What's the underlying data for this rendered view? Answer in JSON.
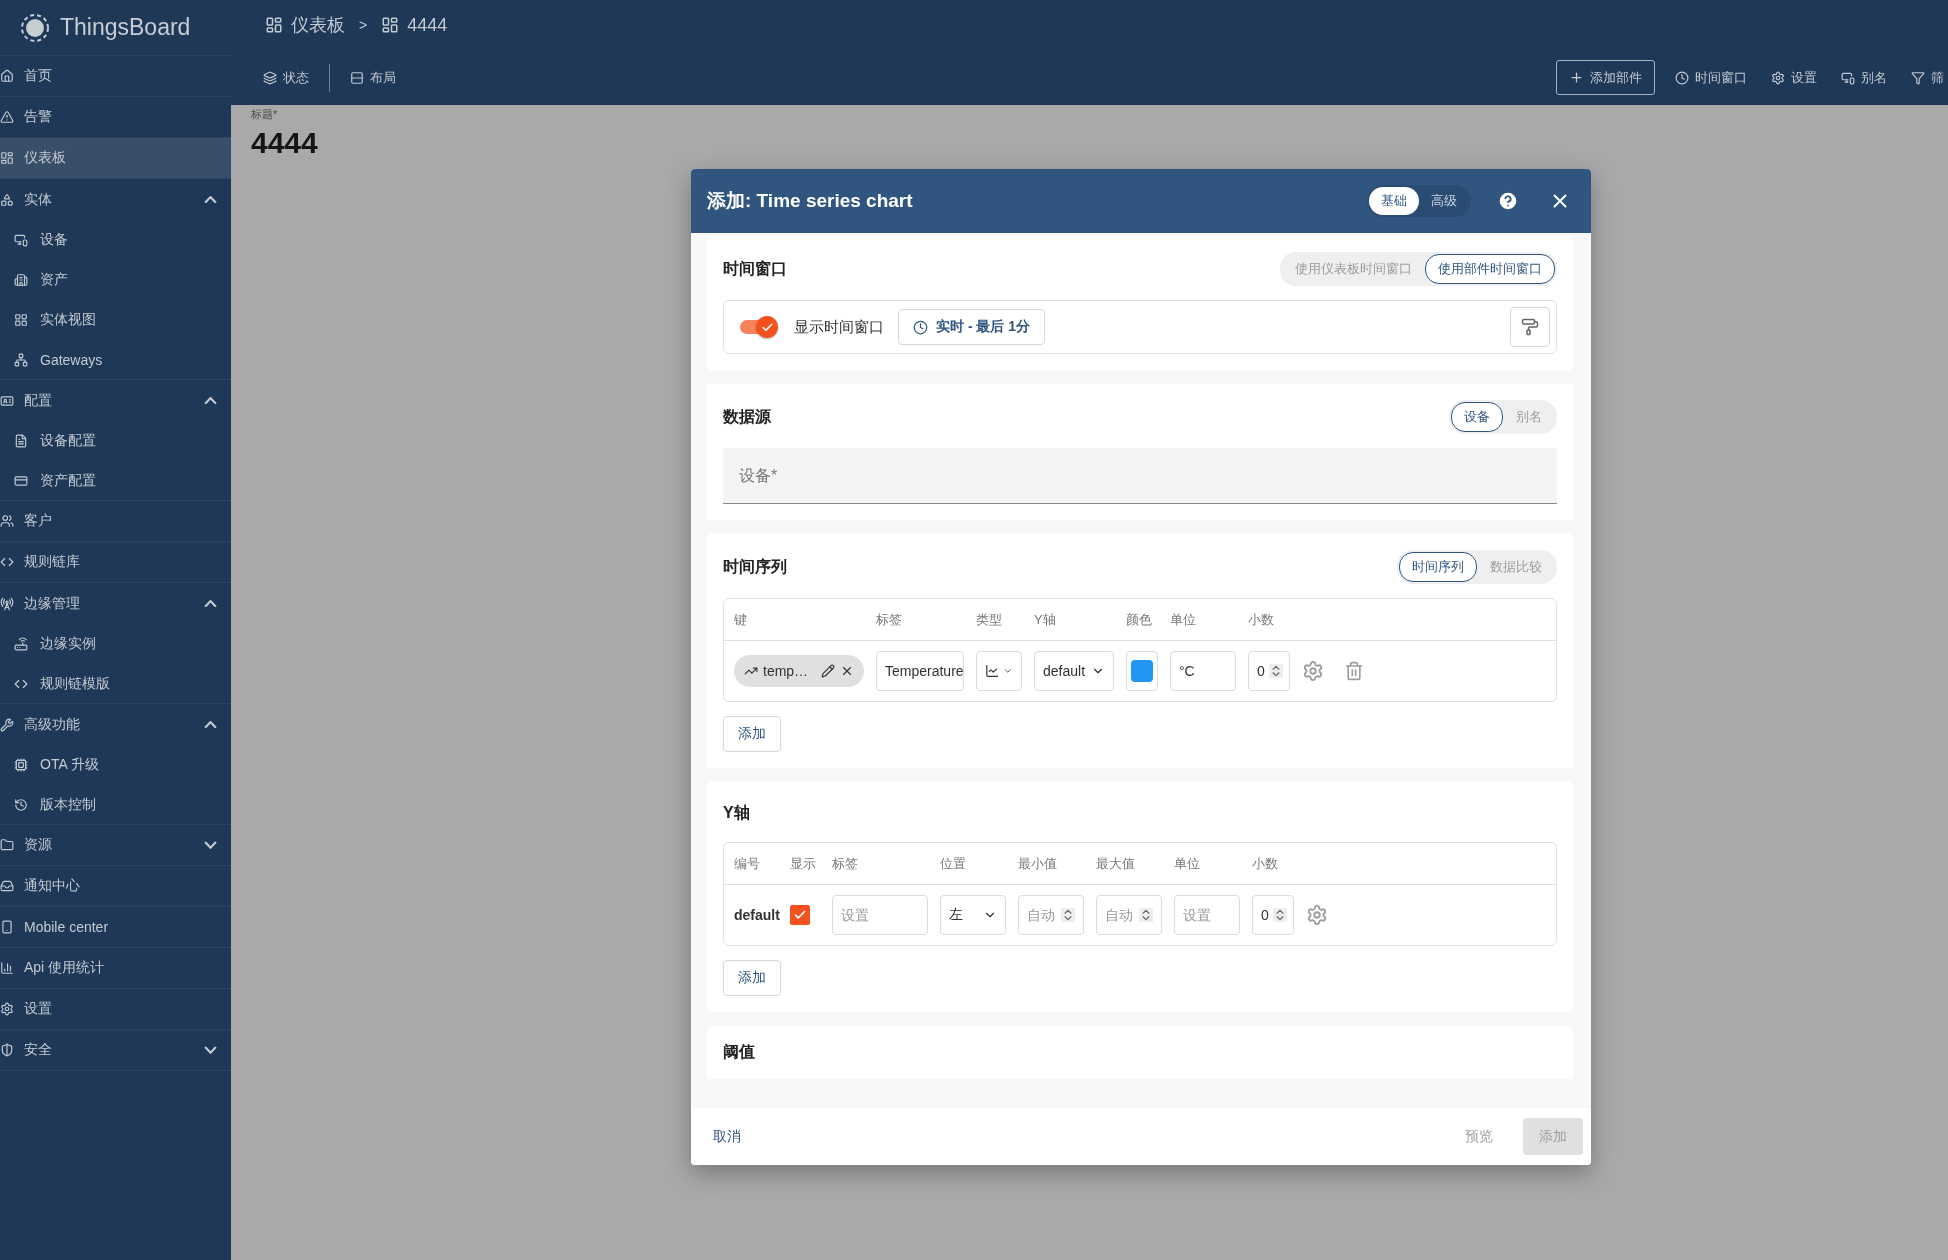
{
  "app": {
    "name": "ThingsBoard"
  },
  "breadcrumb": [
    {
      "label": "仪表板"
    },
    {
      "label": "4444"
    }
  ],
  "breadcrumb_separator": ">",
  "sidebar": {
    "items": [
      {
        "label": "首页",
        "selected": false
      },
      {
        "label": "告警",
        "selected": false
      },
      {
        "label": "仪表板",
        "selected": true
      },
      {
        "label": "实体",
        "selected": false,
        "expanded": true,
        "children": [
          {
            "label": "设备",
            "selected": false
          },
          {
            "label": "资产",
            "selected": false
          },
          {
            "label": "实体视图",
            "selected": false
          },
          {
            "label": "Gateways",
            "selected": false
          }
        ]
      },
      {
        "label": "配置",
        "selected": false,
        "expanded": true,
        "children": [
          {
            "label": "设备配置",
            "selected": false
          },
          {
            "label": "资产配置",
            "selected": false
          }
        ]
      },
      {
        "label": "客户",
        "selected": false
      },
      {
        "label": "规则链库",
        "selected": false
      },
      {
        "label": "边缘管理",
        "selected": false,
        "expanded": true,
        "children": [
          {
            "label": "边缘实例",
            "selected": false
          },
          {
            "label": "规则链模版",
            "selected": false
          }
        ]
      },
      {
        "label": "高级功能",
        "selected": false,
        "expanded": true,
        "children": [
          {
            "label": "OTA 升级",
            "selected": false
          },
          {
            "label": "版本控制",
            "selected": false
          }
        ]
      },
      {
        "label": "资源",
        "selected": false,
        "expanded": false
      },
      {
        "label": "通知中心",
        "selected": false
      },
      {
        "label": "Mobile center",
        "selected": false
      },
      {
        "label": "Api 使用统计",
        "selected": false
      },
      {
        "label": "设置",
        "selected": false
      },
      {
        "label": "安全",
        "selected": false,
        "expanded": false
      }
    ]
  },
  "toolbar": {
    "left": [
      {
        "label": "状态"
      },
      {
        "label": "布局"
      }
    ],
    "add_widget": "添加部件",
    "right": [
      {
        "label": "时间窗口"
      },
      {
        "label": "设置"
      },
      {
        "label": "别名"
      },
      {
        "label": "筛"
      }
    ]
  },
  "title_field": {
    "label": "标题*",
    "value": "4444"
  },
  "dialog": {
    "title": "添加: Time series chart",
    "modes": [
      {
        "label": "基础",
        "selected": true
      },
      {
        "label": "高级",
        "selected": false
      }
    ],
    "time_window": {
      "title": "时间窗口",
      "options": [
        {
          "label": "使用仪表板时间窗口",
          "selected": false
        },
        {
          "label": "使用部件时间窗口",
          "selected": true
        }
      ],
      "show_toggle": {
        "label": "显示时间窗口",
        "on": true
      },
      "interval": "实时 - 最后 1分"
    },
    "datasource": {
      "title": "数据源",
      "options": [
        {
          "label": "设备",
          "selected": true
        },
        {
          "label": "别名",
          "selected": false
        }
      ],
      "field": {
        "placeholder": "设备*"
      }
    },
    "series": {
      "title": "时间序列",
      "options": [
        {
          "label": "时间序列",
          "selected": true
        },
        {
          "label": "数据比较",
          "selected": false
        }
      ],
      "columns": [
        "键",
        "标签",
        "类型",
        "Y轴",
        "颜色",
        "单位",
        "小数"
      ],
      "rows": [
        {
          "key": "temp…",
          "label": "Temperature",
          "axis": "default",
          "color": "#2196f3",
          "unit": "°C",
          "decimals": "0"
        }
      ],
      "add_button": "添加"
    },
    "y_axes": {
      "title": "Y轴",
      "columns": [
        "编号",
        "显示",
        "标签",
        "位置",
        "最小值",
        "最大值",
        "单位",
        "小数"
      ],
      "rows": [
        {
          "id": "default",
          "show": true,
          "label": {
            "placeholder": "设置"
          },
          "position": "左",
          "min": {
            "placeholder": "自动"
          },
          "max": {
            "placeholder": "自动"
          },
          "unit": {
            "placeholder": "设置"
          },
          "decimals": "0"
        }
      ],
      "add_button": "添加"
    },
    "thresholds": {
      "title": "阈值"
    },
    "footer": {
      "cancel": "取消",
      "preview": {
        "label": "预览",
        "disabled": true
      },
      "add": {
        "label": "添加",
        "disabled": true
      }
    }
  }
}
